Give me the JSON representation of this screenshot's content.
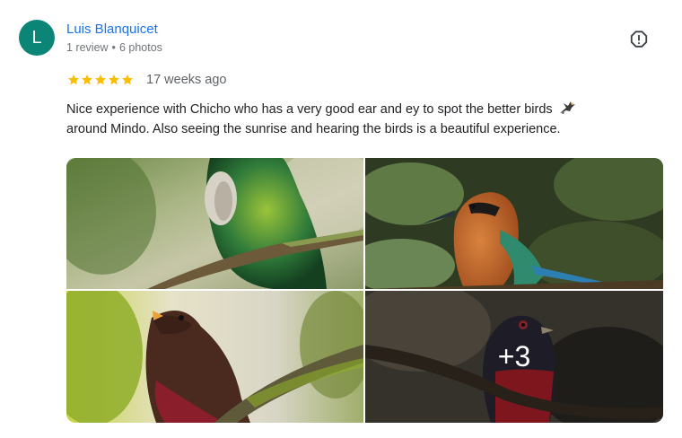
{
  "review": {
    "author": {
      "initial": "L",
      "name": "Luis Blanquicet",
      "review_count": "1 review",
      "separator": "•",
      "photo_count": "6 photos",
      "avatar_color": "#0a8576"
    },
    "rating": 5,
    "rating_max": 5,
    "star_color": "#fbbc04",
    "date": "17 weeks ago",
    "text_line1": "Nice experience with Chicho who has a very good ear and ey to spot the better birds",
    "text_line2": "around Mindo. Also seeing the sunrise and hearing the birds is a beautiful experience.",
    "report_icon": "report-flag-icon",
    "photos": {
      "more_label": "+3"
    }
  }
}
